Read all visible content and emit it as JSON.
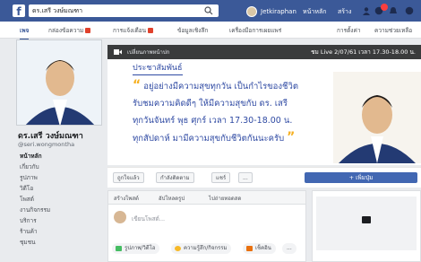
{
  "topbar": {
    "search_value": "ดร.เสรี วงษ์มณฑา",
    "user_name": "Jetkiraphan",
    "links": [
      "หน้าหลัก",
      "สร้าง"
    ]
  },
  "subnav": {
    "tabs": [
      "เพจ",
      "กล่องข้อความ",
      "การแจ้งเตือน",
      "ข้อมูลเชิงลึก",
      "เครื่องมือการเผยแพร่"
    ],
    "right": [
      "การตั้งค่า",
      "ความช่วยเหลือ"
    ]
  },
  "profile": {
    "name": "ดร.เสรี วงษ์มณฑา",
    "handle": "@seri.wongmontha",
    "nav": [
      "หน้าหลัก",
      "เกี่ยวกับ",
      "รูปภาพ",
      "วิดีโอ",
      "โพสต์",
      "งานกิจกรรม",
      "บริการ",
      "ร้านค้า",
      "ชุมชน"
    ]
  },
  "cover": {
    "hint": "เปลี่ยนภาพหน้าปก",
    "live": "ชม Live 2/07/61 เวลา 17.30-18.00 น.",
    "header": "ประชาสัมพันธ์",
    "quote_lines": [
      "อยู่อย่างมีความสุขทุกวัน เป็นกำไรของชีวิต",
      "รับชมความคิดดีๆ ให้มีความสุขกับ ดร. เสรี",
      "ทุกวันจันทร์ พุธ ศุกร์ เวลา 17.30-18.00 น.",
      "ทุกสัปดาห์ มามีความสุขกับชีวิตกันนะครับ"
    ]
  },
  "actions": {
    "buttons": [
      "ถูกใจแล้ว",
      "กำลังติดตาม",
      "แชร์",
      "..."
    ],
    "primary": "+ เพิ่มปุ่ม"
  },
  "composer": {
    "tabs": [
      "สร้างโพสต์",
      "อัปโหลดรูป",
      "ไปถ่ายทอดสด"
    ],
    "placeholder": "เขียนโพสต์...",
    "options": [
      "รูปภาพ/วิดีโอ",
      "ความรู้สึก/กิจกรรม",
      "เช็คอิน",
      "..."
    ]
  },
  "colors": {
    "facebook_blue": "#3b5998",
    "quote_blue": "#2f4aa3",
    "quote_mark": "#f6b021"
  }
}
